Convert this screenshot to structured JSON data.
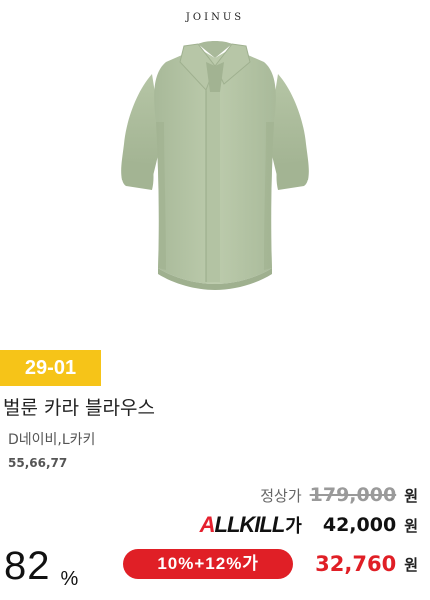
{
  "brand": "JOINUS",
  "product": {
    "image_icon": "green-blouse-photo",
    "code": "29-01",
    "name": "벌룬 카라 블라우스",
    "colors": "D네이비,L카키",
    "sizes": "55,66,77"
  },
  "pricing": {
    "regular_label": "정상가",
    "regular_price": "179,000",
    "allkill_logo_a": "A",
    "allkill_logo_rest": "LLKILL",
    "allkill_logo_ga": "가",
    "allkill_price": "42,000",
    "discount_label": "10%+12%가",
    "final_price": "32,760",
    "currency": "원",
    "discount_percent": "82",
    "percent_sign": "%"
  },
  "colors": {
    "badge": "#f6c418",
    "accent_red": "#e01f26",
    "blouse": "#b8c8a7"
  }
}
